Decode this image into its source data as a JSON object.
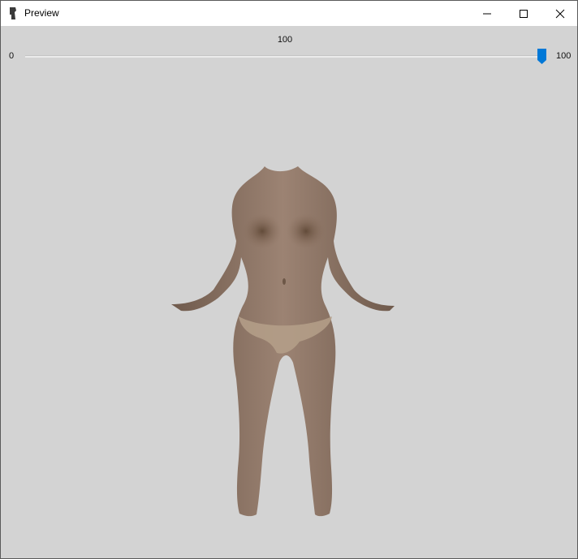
{
  "window": {
    "title": "Preview",
    "controls": {
      "minimize_icon": "minimize-icon",
      "maximize_icon": "maximize-icon",
      "close_icon": "close-icon"
    }
  },
  "slider": {
    "value_label": "100",
    "min_label": "0",
    "max_label": "100",
    "value": 100,
    "min": 0,
    "max": 100,
    "accent_color": "#0078d7"
  },
  "preview": {
    "background_color": "#d3d3d3",
    "model": "body-mesh-preview"
  }
}
